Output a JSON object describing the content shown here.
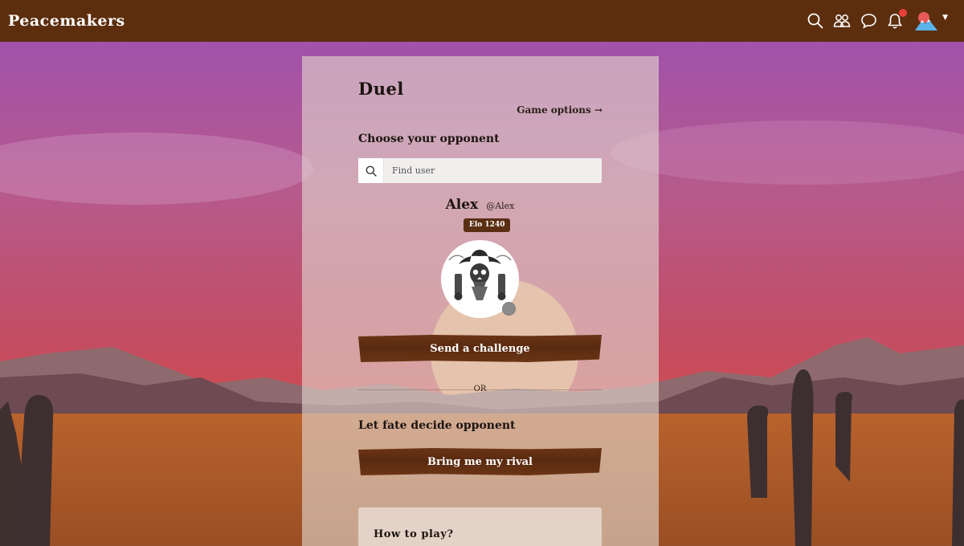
{
  "app": {
    "brand": "Peacemakers"
  },
  "topbar": {
    "icons": [
      "search-icon",
      "friends-icon",
      "chat-icon",
      "bell-icon",
      "avatar-mountain-icon",
      "caret-down-icon"
    ],
    "notification_color": "#e8413a",
    "bar_color": "#5c2e0e"
  },
  "duel": {
    "title": "Duel",
    "game_options_label": "Game options →",
    "choose_label": "Choose your opponent",
    "search": {
      "placeholder": "Find user",
      "value": ""
    },
    "opponent": {
      "name": "Alex",
      "handle": "@Alex",
      "elo_badge": "Elo 1240",
      "status_color": "#8a8a8a"
    },
    "send_challenge_label": "Send a challenge",
    "or_label": "OR",
    "fate_label": "Let fate decide opponent",
    "rival_label": "Bring me my rival",
    "howto_title": "How to play?"
  },
  "colors": {
    "accent_wood": "#5a2e12",
    "sky_top": "#9b4fb3",
    "sky_bottom": "#cf4a4f",
    "desert": "#a2582a"
  }
}
